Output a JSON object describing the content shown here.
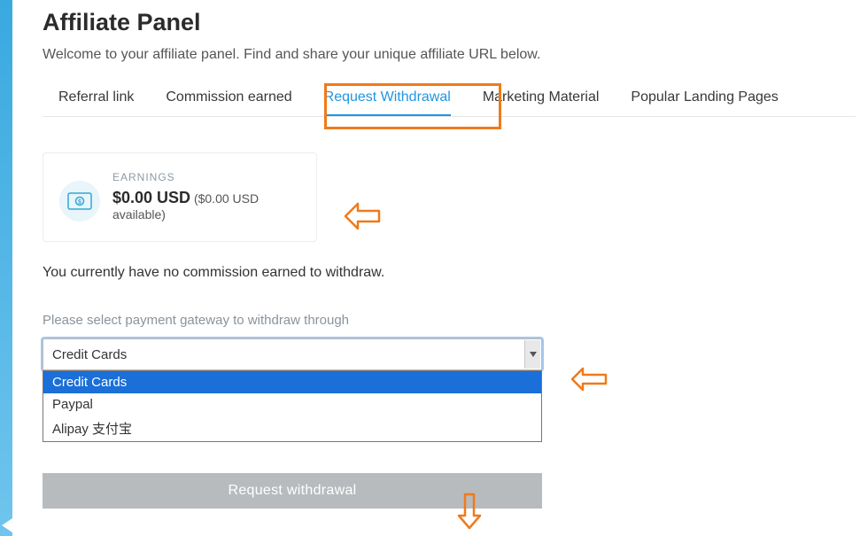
{
  "header": {
    "title": "Affiliate Panel",
    "subtitle": "Welcome to your affiliate panel. Find and share your unique affiliate URL below."
  },
  "tabs": [
    {
      "label": "Referral link",
      "active": false
    },
    {
      "label": "Commission earned",
      "active": false
    },
    {
      "label": "Request Withdrawal",
      "active": true
    },
    {
      "label": "Marketing Material",
      "active": false
    },
    {
      "label": "Popular Landing Pages",
      "active": false
    }
  ],
  "earnings": {
    "label": "EARNINGS",
    "amount": "$0.00 USD",
    "available_suffix": " ($0.00 USD available)"
  },
  "no_commission_text": "You currently have no commission earned to withdraw.",
  "gateway": {
    "label": "Please select payment gateway to withdraw through",
    "selected": "Credit Cards",
    "options": [
      "Credit Cards",
      "Paypal",
      "Alipay 支付宝"
    ]
  },
  "request_button_label": "Request withdrawal",
  "annotations": {
    "highlight_box_color": "#ef7a1a"
  }
}
